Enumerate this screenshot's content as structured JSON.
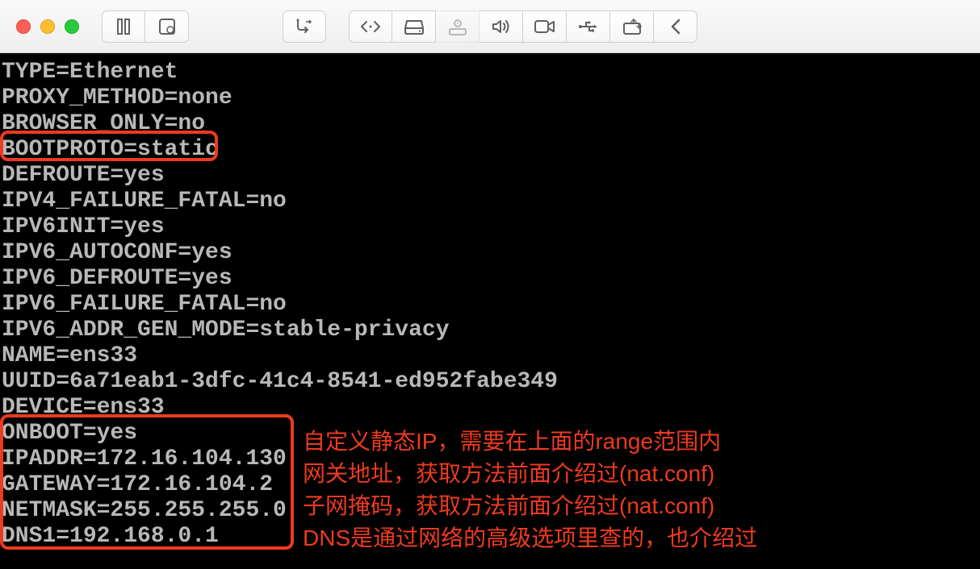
{
  "config_lines": [
    "TYPE=Ethernet",
    "PROXY_METHOD=none",
    "BROWSER_ONLY=no",
    "BOOTPROTO=static",
    "DEFROUTE=yes",
    "IPV4_FAILURE_FATAL=no",
    "IPV6INIT=yes",
    "IPV6_AUTOCONF=yes",
    "IPV6_DEFROUTE=yes",
    "IPV6_FAILURE_FATAL=no",
    "IPV6_ADDR_GEN_MODE=stable-privacy",
    "NAME=ens33",
    "UUID=6a71eab1-3dfc-41c4-8541-ed952fabe349",
    "DEVICE=ens33",
    "ONBOOT=yes",
    "IPADDR=172.16.104.130",
    "GATEWAY=172.16.104.2",
    "NETMASK=255.255.255.0",
    "DNS1=192.168.0.1"
  ],
  "annotations": {
    "line1": "自定义静态IP，需要在上面的range范围内",
    "line2": "网关地址，获取方法前面介绍过(nat.conf)",
    "line3": "子网掩码，获取方法前面介绍过(nat.conf)",
    "line4": "DNS是通过网络的高级选项里查的，也介绍过"
  },
  "colors": {
    "highlight": "#ee3a1f",
    "terminal_text": "#b8b8b8"
  }
}
